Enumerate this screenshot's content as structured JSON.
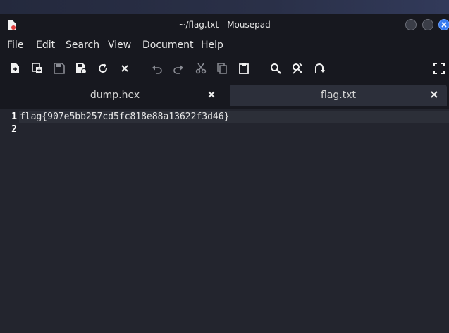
{
  "window": {
    "title": "~/flag.txt - Mousepad"
  },
  "menubar": {
    "items": [
      "File",
      "Edit",
      "Search",
      "View",
      "Document",
      "Help"
    ]
  },
  "toolbar": {
    "icons": [
      "new-document-icon",
      "new-window-icon",
      "save-icon",
      "save-as-icon",
      "reload-icon",
      "close-document-icon",
      "undo-icon",
      "redo-icon",
      "cut-icon",
      "copy-icon",
      "paste-icon",
      "find-icon",
      "find-replace-icon",
      "goto-line-icon",
      "fullscreen-icon"
    ]
  },
  "tabs": [
    {
      "label": "dump.hex",
      "active": false
    },
    {
      "label": "flag.txt",
      "active": true
    }
  ],
  "editor": {
    "lines": [
      {
        "number": "1",
        "text": "flag{907e5bb257cd5fc818e88a13622f3d46}"
      },
      {
        "number": "2",
        "text": ""
      }
    ]
  },
  "colors": {
    "chrome": "#17181f",
    "editor_bg": "#23252e",
    "active_tab": "#2c2f3a",
    "accent": "#367bf0"
  }
}
